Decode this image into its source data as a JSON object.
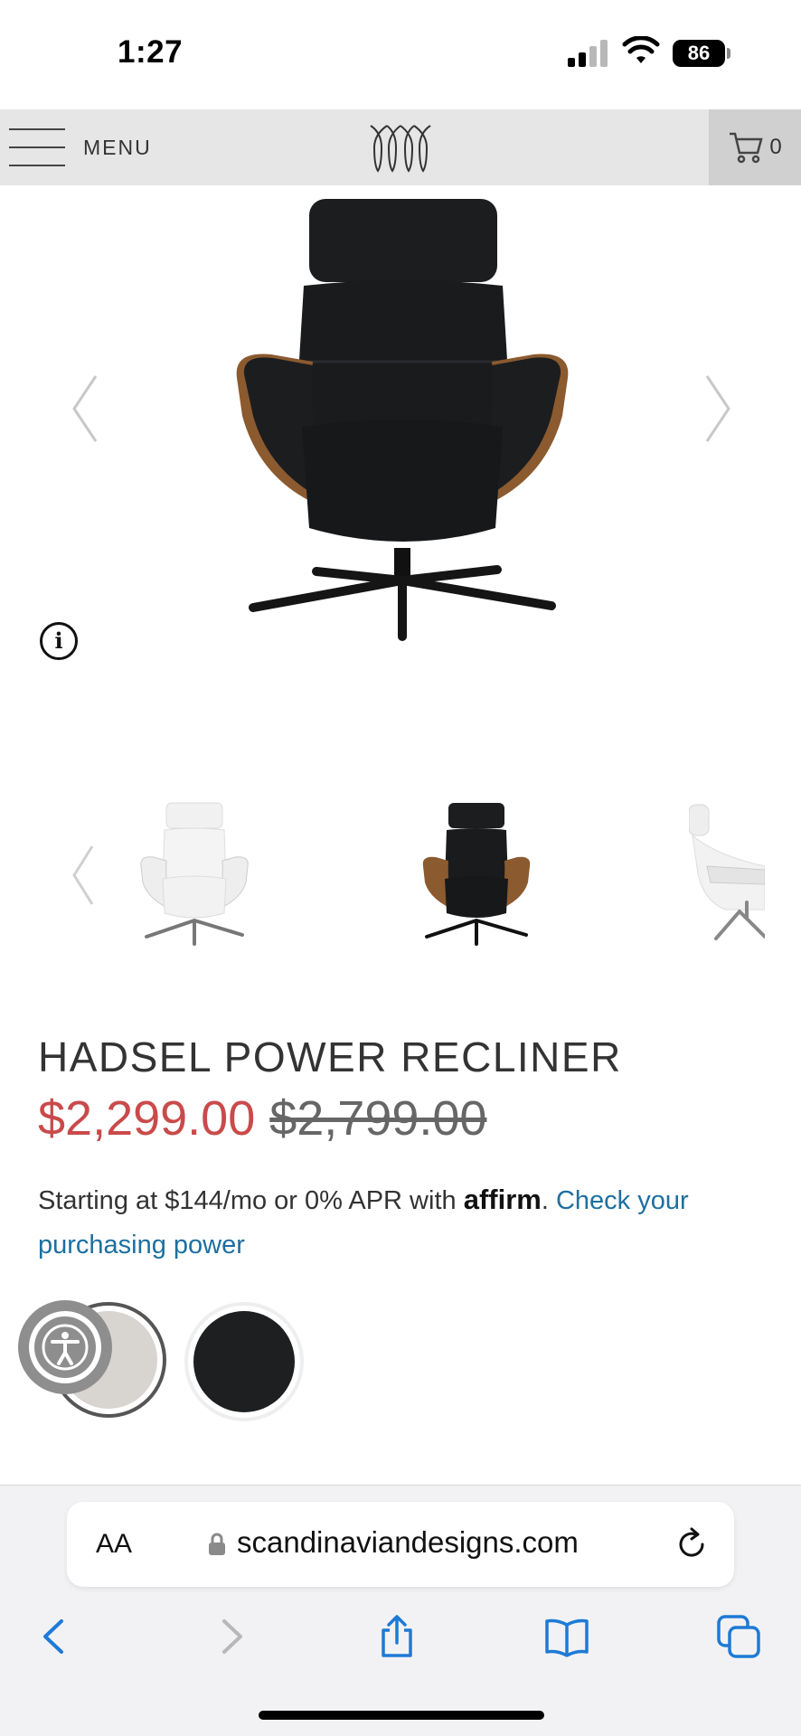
{
  "status_bar": {
    "time": "1:27",
    "battery": "86"
  },
  "header": {
    "menu_label": "MENU",
    "cart_count": "0"
  },
  "product": {
    "title": "HADSEL POWER RECLINER",
    "sale_price": "$2,299.00",
    "original_price": "$2,799.00",
    "financing_prefix": "Starting at $144/mo or 0% APR with",
    "affirm_brand": "affirm",
    "financing_separator": ".",
    "financing_link": "Check your purchasing power"
  },
  "swatches": [
    {
      "name": "light",
      "color": "#d8d4d0"
    },
    {
      "name": "dark",
      "color": "#1e1f21"
    }
  ],
  "browser": {
    "text_size_label": "AA",
    "url": "scandinaviandesigns.com"
  },
  "colors": {
    "sale_red": "#c94a4a",
    "link_blue": "#1d6fa0",
    "ios_blue": "#1e7ad6"
  },
  "icons": [
    "signal-icon",
    "wifi-icon",
    "battery-icon",
    "hamburger-icon",
    "logo-icon",
    "cart-icon",
    "chevron-left-icon",
    "chevron-right-icon",
    "info-icon",
    "accessibility-icon",
    "lock-icon",
    "reload-icon",
    "back-icon",
    "forward-icon",
    "share-icon",
    "bookmarks-icon",
    "tabs-icon"
  ]
}
